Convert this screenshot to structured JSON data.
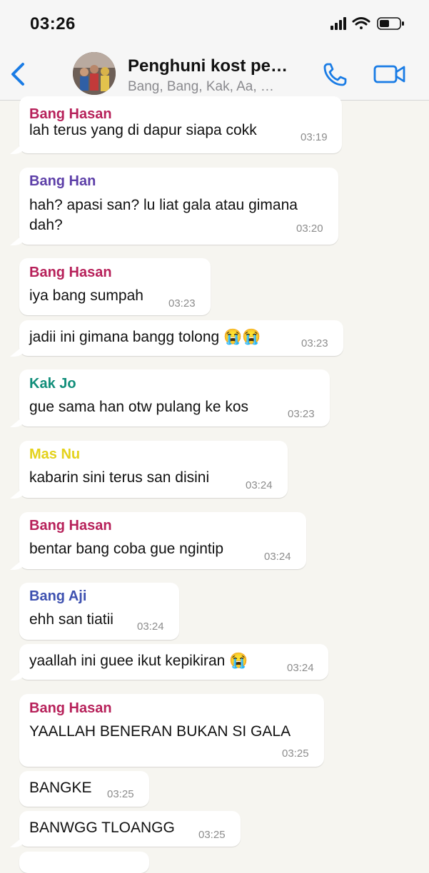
{
  "status_bar": {
    "time": "03:26"
  },
  "header": {
    "title": "Penghuni kost pe…",
    "subtitle": "Bang, Bang, Kak, Aa, …"
  },
  "colors": {
    "accent": "#1a7ce5",
    "bang_hasan": "#b7215a",
    "bang_han": "#5d3fa8",
    "kak_jo": "#118e7a",
    "mas_nu": "#e4d21b",
    "bang_aji": "#3e51b0"
  },
  "messages": [
    {
      "sender": "Bang Hasan",
      "lines": [
        "lah terus yang di dapur siapa cokk"
      ],
      "time": "03:19"
    },
    {
      "sender": "Bang Han",
      "lines": [
        "hah? apasi san? lu liat gala atau gimana",
        "dah?"
      ],
      "time": "03:20"
    },
    {
      "sender": "Bang Hasan",
      "lines": [
        "iya bang sumpah"
      ],
      "time": "03:23"
    },
    {
      "sender": "",
      "lines": [
        "jadii ini gimana bangg tolong 😭😭"
      ],
      "time": "03:23"
    },
    {
      "sender": "Kak Jo",
      "lines": [
        "gue sama han otw pulang ke kos"
      ],
      "time": "03:23"
    },
    {
      "sender": "Mas Nu",
      "lines": [
        "kabarin sini terus san disini"
      ],
      "time": "03:24"
    },
    {
      "sender": "Bang Hasan",
      "lines": [
        "bentar bang coba gue ngintip"
      ],
      "time": "03:24"
    },
    {
      "sender": "Bang Aji",
      "lines": [
        "ehh san tiatii"
      ],
      "time": "03:24"
    },
    {
      "sender": "",
      "lines": [
        "yaallah ini guee ikut kepikiran 😭"
      ],
      "time": "03:24"
    },
    {
      "sender": "Bang Hasan",
      "lines": [
        "YAALLAH BENERAN BUKAN SI GALA"
      ],
      "time": "03:25"
    },
    {
      "sender": "",
      "lines": [
        "BANGKE"
      ],
      "time": "03:25"
    },
    {
      "sender": "",
      "lines": [
        "BANWGG TLOANGG"
      ],
      "time": "03:25"
    }
  ]
}
